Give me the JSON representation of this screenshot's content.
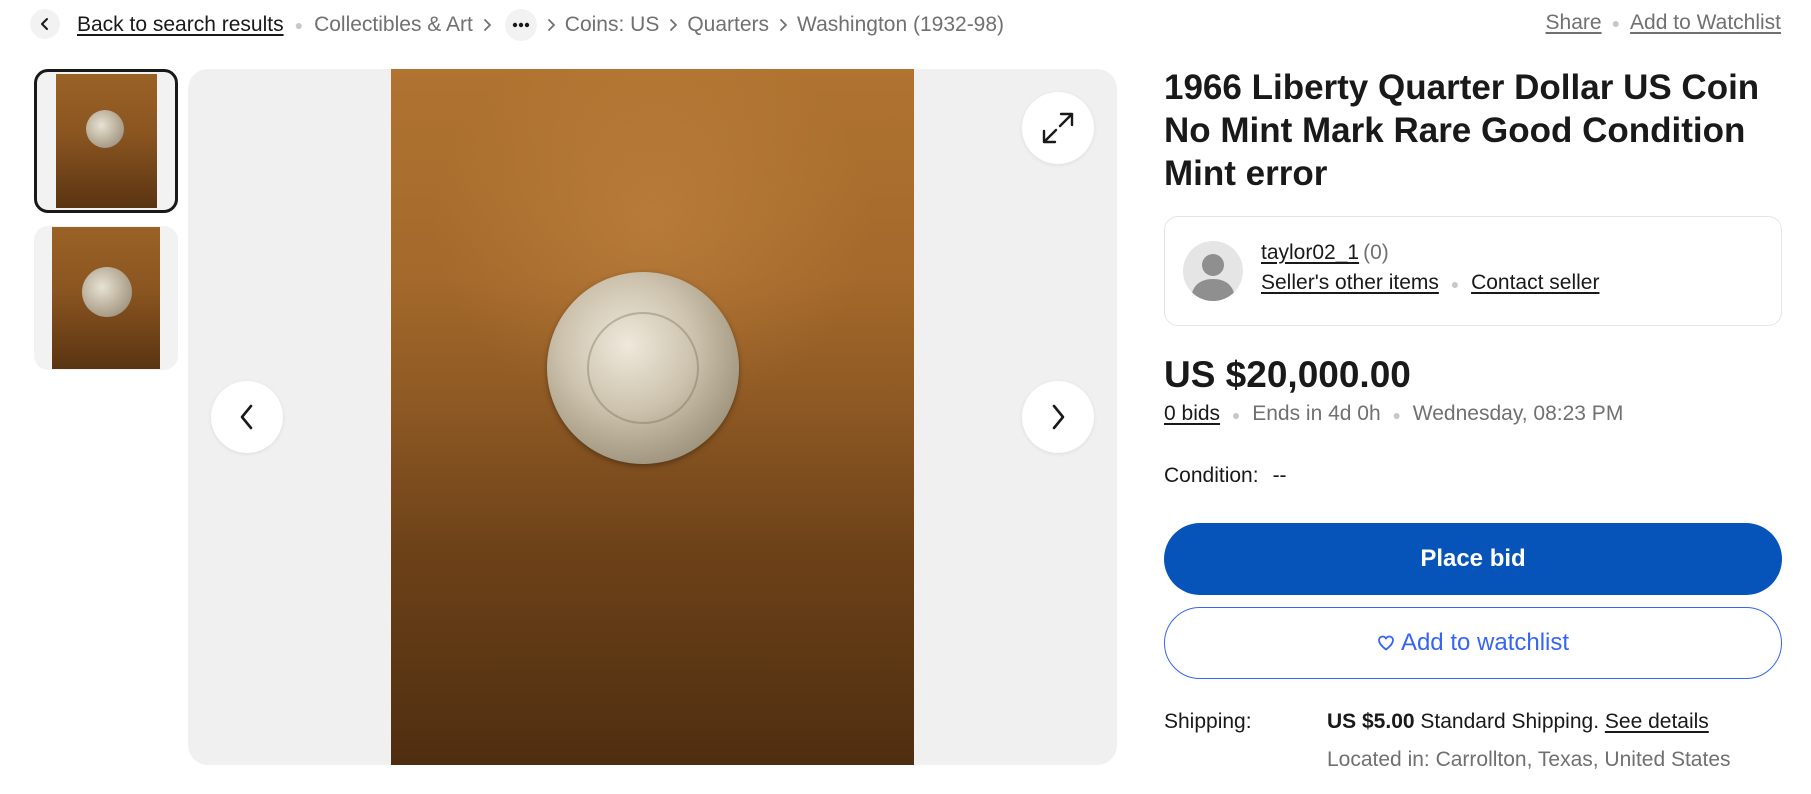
{
  "breadcrumb": {
    "back_label": "Back to search results",
    "items": [
      "Collectibles & Art",
      "Coins: US",
      "Quarters",
      "Washington (1932-98)"
    ],
    "more_label": "…"
  },
  "top_actions": {
    "share": "Share",
    "watchlist": "Add to Watchlist"
  },
  "listing": {
    "title": "1966 Liberty Quarter Dollar US Coin No Mint Mark Rare Good Condition Mint error",
    "image_count": 2,
    "selected_image": 1
  },
  "seller": {
    "name": "taylor02_1",
    "feedback": "(0)",
    "other_items": "Seller's other items",
    "contact": "Contact seller"
  },
  "price": {
    "amount": "US $20,000.00",
    "bids": "0 bids",
    "ends": "Ends in 4d 0h",
    "end_time": "Wednesday, 08:23 PM"
  },
  "condition": {
    "label": "Condition:",
    "value": "--"
  },
  "buttons": {
    "place_bid": "Place bid",
    "add_watchlist": "Add to watchlist"
  },
  "shipping": {
    "label": "Shipping:",
    "cost": "US $5.00",
    "method": "Standard Shipping.",
    "details": "See details",
    "location": "Located in: Carrollton, Texas, United States"
  },
  "colors": {
    "primary": "#0654ba",
    "link_blue": "#3665f3",
    "text": "#191919",
    "muted": "#707070"
  }
}
